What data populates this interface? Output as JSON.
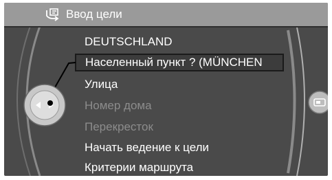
{
  "header": {
    "title": "Ввод цели",
    "icon": "destination-input-icon"
  },
  "menu": {
    "items": [
      {
        "label": "DEUTSCHLAND",
        "state": "enabled"
      },
      {
        "label": "Населенный пункт  ? (MÜNCHEN",
        "state": "selected"
      },
      {
        "label": "Улица",
        "state": "enabled"
      },
      {
        "label": "Номер дома",
        "state": "disabled"
      },
      {
        "label": "Перекресток",
        "state": "disabled"
      },
      {
        "label": "Начать ведение к цели",
        "state": "enabled"
      },
      {
        "label": "Критерии маршрута",
        "state": "enabled"
      }
    ]
  },
  "controller": {
    "icon": "idrive-controller-icon",
    "directions": [
      "left",
      "right"
    ]
  },
  "side_button": {
    "icon": "option-button-icon"
  },
  "colors": {
    "screen_bg": "#4a4a4a",
    "title_bg": "#9a9a9a",
    "text_enabled": "#ffffff",
    "text_disabled": "#8c8c8c",
    "selection_border": "#1a1a1a"
  }
}
